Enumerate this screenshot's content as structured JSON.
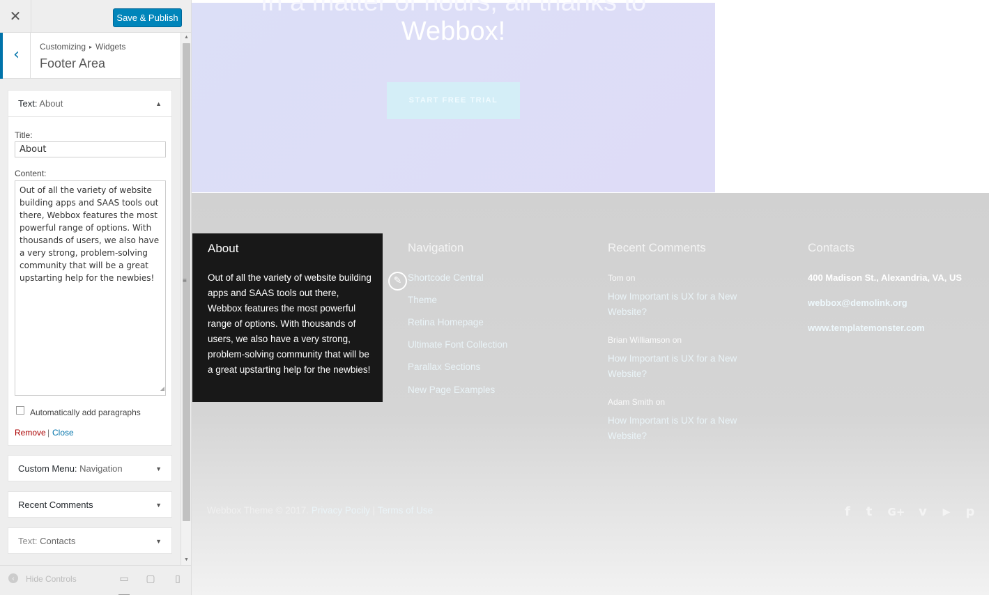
{
  "customizer": {
    "close_glyph": "✕",
    "save_label": "Save & Publish",
    "back_glyph": "‹",
    "breadcrumb_root": "Customizing",
    "breadcrumb_arrow": "▸",
    "breadcrumb_current": "Widgets",
    "section_title": "Footer Area",
    "scroll_up": "▲",
    "scroll_down": "▼",
    "resize_grip": "≡"
  },
  "widgets": {
    "about": {
      "type": "Text:",
      "name": "About",
      "caret": "▲",
      "title_label": "Title:",
      "title_value": "About",
      "content_label": "Content:",
      "content_value": "Out of all the variety of website building apps and SAAS tools out there, Webbox features the most powerful range of options. With thousands of users, we also have a very strong, problem-solving community that will be a great upstarting help for the newbies!",
      "auto_paragraphs_label": "Automatically add paragraphs",
      "auto_paragraphs_checked": false,
      "remove_label": "Remove",
      "separator": "|",
      "close_label": "Close"
    },
    "menu": {
      "type": "Custom Menu:",
      "name": "Navigation",
      "caret": "▼"
    },
    "comments": {
      "type": "Recent Comments",
      "caret": "▼"
    },
    "contacts": {
      "type": "Text:",
      "name": "Contacts",
      "caret": "▼"
    }
  },
  "footer_controls": {
    "hide_icon": "‹",
    "hide_label": "Hide Controls",
    "devices": [
      "desktop-icon",
      "tablet-icon",
      "mobile-icon"
    ],
    "device_glyphs": [
      "▭",
      "▢",
      "▯"
    ]
  },
  "preview": {
    "hero_line1": "In a matter of hours, all thanks to",
    "hero_line2": "Webbox!",
    "trial_button": "START FREE TRIAL",
    "about_title": "About",
    "about_text": "Out of all the variety of website building apps and SAAS tools out there, Webbox features the most powerful range of options. With thousands of users, we also have a very strong, problem-solving community that will be a great upstarting help for the newbies!",
    "edit_glyph": "✎",
    "nav_title": "Navigation",
    "nav_links": [
      "Shortcode Central",
      "Theme",
      "Retina Homepage",
      "Ultimate Font Collection",
      "Parallax Sections",
      "New Page Examples"
    ],
    "comments_title": "Recent Comments",
    "comments": [
      {
        "author": "Tom",
        "on": "on",
        "post": "How Important is UX for a New Website?"
      },
      {
        "author": "Brian Williamson",
        "on": "on",
        "post": "How Important is UX for a New Website?"
      },
      {
        "author": "Adam Smith",
        "on": "on",
        "post": "How Important is UX for a New Website?"
      }
    ],
    "contacts_title": "Contacts",
    "address": "400 Madison St., Alexandria, VA, US",
    "email": "webbox@demolink.org",
    "website": "www.templatemonster.com",
    "copyright": "Webbox Theme © 2017.",
    "privacy": "Privacy Pocily",
    "copyright_sep": "|",
    "terms": "Terms of Use",
    "social": [
      {
        "icon": "facebook-icon",
        "glyph": "f"
      },
      {
        "icon": "twitter-icon",
        "glyph": "t"
      },
      {
        "icon": "google-plus-icon",
        "glyph": "G+"
      },
      {
        "icon": "vimeo-icon",
        "glyph": "v"
      },
      {
        "icon": "youtube-icon",
        "glyph": "▶"
      },
      {
        "icon": "pinterest-icon",
        "glyph": "p"
      }
    ]
  },
  "colors": {
    "accent": "#0085ba",
    "hero_bg": "#dcdff7",
    "footer_bg": "#d1d1d1",
    "about_box": "#181818"
  }
}
